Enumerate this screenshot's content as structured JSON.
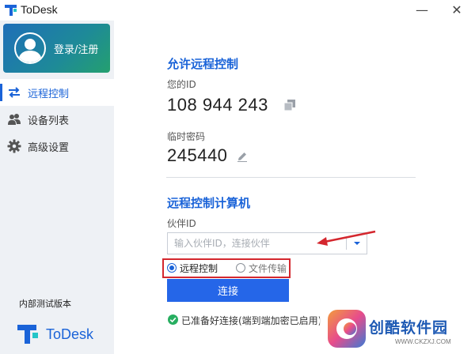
{
  "window": {
    "title": "ToDesk"
  },
  "sidebar": {
    "login_label": "登录/注册",
    "items": [
      {
        "label": "远程控制",
        "icon": "swap-arrows-icon",
        "active": true
      },
      {
        "label": "设备列表",
        "icon": "users-icon",
        "active": false
      },
      {
        "label": "高级设置",
        "icon": "gear-icon",
        "active": false
      }
    ],
    "version": "内部测试版本",
    "brand": "ToDesk"
  },
  "allow": {
    "title": "允许远程控制",
    "id_label": "您的ID",
    "id_value": "108 944 243",
    "pw_label": "临时密码",
    "pw_value": "245440"
  },
  "control": {
    "title": "远程控制计算机",
    "partner_label": "伙伴ID",
    "partner_placeholder": "输入伙伴ID，连接伙伴",
    "mode_remote": "远程控制",
    "mode_file": "文件传输",
    "selected_mode": "远程控制",
    "connect_label": "连接",
    "status_text": "已准备好连接(端到端加密已启用)"
  },
  "watermark": {
    "title": "创酷软件园",
    "url": "WWW.CKZXJ.COM"
  },
  "colors": {
    "accent": "#1a63d8",
    "button": "#2566e8",
    "annotation": "#d4272e",
    "ok": "#27ae60"
  }
}
